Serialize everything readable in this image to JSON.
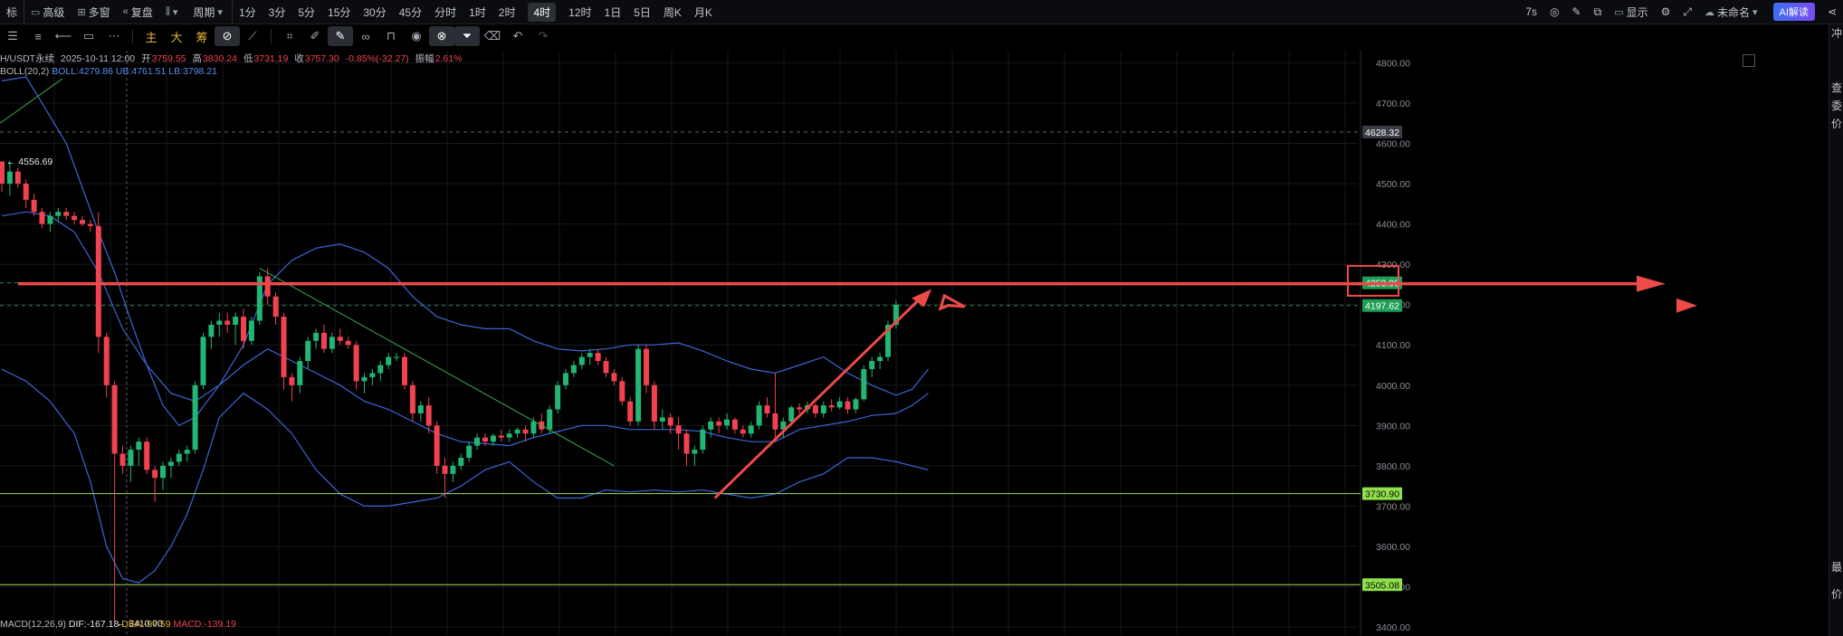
{
  "topbar": {
    "items": [
      {
        "label": "标",
        "icon": ""
      },
      {
        "label": "高级",
        "icon": "window-icon"
      },
      {
        "label": "多窗",
        "icon": "grid-icon"
      },
      {
        "label": "复盘",
        "icon": "rewind-icon"
      },
      {
        "label": "",
        "icon": "candle-icon"
      },
      {
        "label": "周期",
        "icon": ""
      }
    ],
    "periods": [
      "1分",
      "3分",
      "5分",
      "15分",
      "30分",
      "45分",
      "分时",
      "1时",
      "2时",
      "4时",
      "12时",
      "1日",
      "5日",
      "周K",
      "月K"
    ],
    "active_period": "4时",
    "right": {
      "refresh": "7s",
      "display": "显示",
      "layout_name": "未命名",
      "ai_button": "AI解读"
    }
  },
  "toolbar2": {
    "main": "主",
    "big": "大",
    "chip": "筹"
  },
  "info": {
    "symbol": "H/USDT永续",
    "datetime": "2025-10-11 12:00",
    "open_label": "开",
    "open": "3759.55",
    "high_label": "高",
    "high": "3830.24",
    "low_label": "低",
    "low": "3731.19",
    "close_label": "收",
    "close": "3757.30",
    "change": "-0.85%(-32.27)",
    "amp_label": "振幅",
    "amp": "2.61%"
  },
  "boll": {
    "name": "BOLL(20,2)",
    "mid": "BOLL:4279.86",
    "ub": "UB:4761.51",
    "lb": "LB:3798.21"
  },
  "macd": {
    "name": "MACD(12,26,9)",
    "dif": "DIF:-167.18",
    "dea": "DEA:-97.59",
    "macd": "MACD:-139.19"
  },
  "chart_data": {
    "type": "candlestick",
    "ylim": [
      3380,
      4830
    ],
    "y_ticks": [
      "4800.00",
      "4700.00",
      "4600.00",
      "4500.00",
      "4400.00",
      "4300.00",
      "4200.00",
      "4100.00",
      "4000.00",
      "3900.00",
      "3800.00",
      "3700.00",
      "3600.00",
      "3500.00",
      "3400.00"
    ],
    "candles": [
      [
        4555,
        4555,
        4480,
        4500
      ],
      [
        4500,
        4556.69,
        4470,
        4530
      ],
      [
        4530,
        4540,
        4490,
        4500
      ],
      [
        4500,
        4510,
        4440,
        4460
      ],
      [
        4460,
        4475,
        4420,
        4430
      ],
      [
        4430,
        4440,
        4390,
        4400
      ],
      [
        4400,
        4430,
        4380,
        4420
      ],
      [
        4420,
        4440,
        4405,
        4430
      ],
      [
        4430,
        4440,
        4410,
        4420
      ],
      [
        4420,
        4430,
        4400,
        4410
      ],
      [
        4410,
        4420,
        4395,
        4400
      ],
      [
        4400,
        4410,
        4380,
        4395
      ],
      [
        4395,
        4430,
        4080,
        4120
      ],
      [
        4120,
        4130,
        3970,
        4000
      ],
      [
        4000,
        4010,
        3410,
        3830
      ],
      [
        3830,
        3850,
        3780,
        3800
      ],
      [
        3800,
        3850,
        3760,
        3840
      ],
      [
        3840,
        3870,
        3800,
        3860
      ],
      [
        3860,
        3870,
        3780,
        3790
      ],
      [
        3790,
        3800,
        3710,
        3770
      ],
      [
        3770,
        3810,
        3740,
        3800
      ],
      [
        3800,
        3820,
        3770,
        3810
      ],
      [
        3810,
        3840,
        3800,
        3830
      ],
      [
        3830,
        3850,
        3810,
        3840
      ],
      [
        3840,
        4010,
        3830,
        4000
      ],
      [
        4000,
        4130,
        3990,
        4120
      ],
      [
        4120,
        4160,
        4090,
        4150
      ],
      [
        4150,
        4180,
        4120,
        4160
      ],
      [
        4160,
        4180,
        4130,
        4150
      ],
      [
        4150,
        4180,
        4100,
        4170
      ],
      [
        4170,
        4190,
        4090,
        4110
      ],
      [
        4110,
        4170,
        4100,
        4160
      ],
      [
        4160,
        4280,
        4150,
        4270
      ],
      [
        4270,
        4290,
        4200,
        4220
      ],
      [
        4220,
        4230,
        4150,
        4170
      ],
      [
        4170,
        4180,
        3990,
        4020
      ],
      [
        4020,
        4030,
        3960,
        4000
      ],
      [
        4000,
        4070,
        3980,
        4060
      ],
      [
        4060,
        4120,
        4040,
        4110
      ],
      [
        4110,
        4140,
        4090,
        4130
      ],
      [
        4130,
        4150,
        4080,
        4090
      ],
      [
        4090,
        4130,
        4080,
        4120
      ],
      [
        4120,
        4140,
        4100,
        4110
      ],
      [
        4110,
        4120,
        4090,
        4100
      ],
      [
        4100,
        4110,
        3990,
        4010
      ],
      [
        4010,
        4030,
        3980,
        4020
      ],
      [
        4020,
        4040,
        4000,
        4030
      ],
      [
        4030,
        4060,
        4010,
        4050
      ],
      [
        4050,
        4080,
        4040,
        4070
      ],
      [
        4070,
        4080,
        4060,
        4070
      ],
      [
        4070,
        4080,
        3990,
        4000
      ],
      [
        4000,
        4010,
        3910,
        3930
      ],
      [
        3930,
        3960,
        3910,
        3950
      ],
      [
        3950,
        3970,
        3880,
        3900
      ],
      [
        3900,
        3910,
        3780,
        3800
      ],
      [
        3800,
        3820,
        3720,
        3780
      ],
      [
        3780,
        3810,
        3760,
        3800
      ],
      [
        3800,
        3830,
        3790,
        3820
      ],
      [
        3820,
        3860,
        3810,
        3850
      ],
      [
        3850,
        3880,
        3840,
        3870
      ],
      [
        3870,
        3880,
        3850,
        3860
      ],
      [
        3860,
        3880,
        3850,
        3875
      ],
      [
        3875,
        3890,
        3860,
        3870
      ],
      [
        3870,
        3890,
        3860,
        3880
      ],
      [
        3880,
        3895,
        3870,
        3890
      ],
      [
        3890,
        3900,
        3860,
        3880
      ],
      [
        3880,
        3920,
        3870,
        3910
      ],
      [
        3910,
        3930,
        3880,
        3890
      ],
      [
        3890,
        3950,
        3880,
        3940
      ],
      [
        3940,
        4010,
        3930,
        4000
      ],
      [
        4000,
        4040,
        3990,
        4030
      ],
      [
        4030,
        4060,
        4020,
        4050
      ],
      [
        4050,
        4080,
        4040,
        4070
      ],
      [
        4070,
        4090,
        4050,
        4080
      ],
      [
        4080,
        4090,
        4050,
        4060
      ],
      [
        4060,
        4070,
        4020,
        4030
      ],
      [
        4030,
        4040,
        4000,
        4010
      ],
      [
        4010,
        4020,
        3950,
        3960
      ],
      [
        3960,
        3970,
        3900,
        3910
      ],
      [
        3910,
        4100,
        3900,
        4090
      ],
      [
        4090,
        4100,
        3980,
        4000
      ],
      [
        4000,
        4010,
        3890,
        3910
      ],
      [
        3910,
        3940,
        3890,
        3920
      ],
      [
        3920,
        3930,
        3880,
        3900
      ],
      [
        3900,
        3920,
        3840,
        3880
      ],
      [
        3880,
        3890,
        3800,
        3830
      ],
      [
        3830,
        3850,
        3800,
        3840
      ],
      [
        3840,
        3900,
        3830,
        3890
      ],
      [
        3890,
        3920,
        3870,
        3910
      ],
      [
        3910,
        3920,
        3880,
        3900
      ],
      [
        3900,
        3930,
        3890,
        3915
      ],
      [
        3915,
        3920,
        3880,
        3890
      ],
      [
        3890,
        3900,
        3870,
        3880
      ],
      [
        3880,
        3910,
        3870,
        3900
      ],
      [
        3900,
        3960,
        3890,
        3950
      ],
      [
        3950,
        3970,
        3920,
        3930
      ],
      [
        3930,
        4030,
        3860,
        3890
      ],
      [
        3890,
        3920,
        3870,
        3910
      ],
      [
        3910,
        3950,
        3900,
        3945
      ],
      [
        3945,
        3955,
        3930,
        3940
      ],
      [
        3940,
        3960,
        3930,
        3950
      ],
      [
        3950,
        3955,
        3920,
        3930
      ],
      [
        3930,
        3960,
        3920,
        3950
      ],
      [
        3950,
        3965,
        3935,
        3945
      ],
      [
        3945,
        3970,
        3940,
        3960
      ],
      [
        3960,
        3970,
        3930,
        3940
      ],
      [
        3940,
        3970,
        3930,
        3965
      ],
      [
        3965,
        4050,
        3960,
        4040
      ],
      [
        4040,
        4070,
        4020,
        4060
      ],
      [
        4060,
        4080,
        4040,
        4070
      ],
      [
        4070,
        4160,
        4060,
        4150
      ],
      [
        4150,
        4210,
        4140,
        4200
      ]
    ],
    "boll_upper": [
      [
        0,
        4755
      ],
      [
        3,
        4765
      ],
      [
        5,
        4700
      ],
      [
        8,
        4600
      ],
      [
        10,
        4490
      ],
      [
        12,
        4380
      ],
      [
        14,
        4280
      ],
      [
        16,
        4160
      ],
      [
        18,
        4050
      ],
      [
        20,
        3950
      ],
      [
        22,
        3900
      ],
      [
        24,
        3920
      ],
      [
        27,
        4000
      ],
      [
        30,
        4100
      ],
      [
        33,
        4250
      ],
      [
        36,
        4310
      ],
      [
        39,
        4340
      ],
      [
        42,
        4350
      ],
      [
        45,
        4330
      ],
      [
        48,
        4290
      ],
      [
        51,
        4220
      ],
      [
        54,
        4170
      ],
      [
        57,
        4150
      ],
      [
        60,
        4140
      ],
      [
        63,
        4140
      ],
      [
        66,
        4110
      ],
      [
        69,
        4090
      ],
      [
        72,
        4085
      ],
      [
        75,
        4090
      ],
      [
        78,
        4100
      ],
      [
        81,
        4100
      ],
      [
        84,
        4105
      ],
      [
        87,
        4085
      ],
      [
        90,
        4060
      ],
      [
        93,
        4040
      ],
      [
        96,
        4030
      ],
      [
        99,
        4050
      ],
      [
        102,
        4070
      ],
      [
        105,
        4030
      ],
      [
        108,
        4000
      ],
      [
        111,
        3975
      ],
      [
        113,
        3990
      ],
      [
        115,
        4040
      ]
    ],
    "boll_middle": [
      [
        0,
        4420
      ],
      [
        3,
        4430
      ],
      [
        6,
        4420
      ],
      [
        9,
        4380
      ],
      [
        12,
        4280
      ],
      [
        15,
        4140
      ],
      [
        18,
        4050
      ],
      [
        21,
        3980
      ],
      [
        24,
        3960
      ],
      [
        27,
        4000
      ],
      [
        30,
        4050
      ],
      [
        33,
        4090
      ],
      [
        36,
        4060
      ],
      [
        39,
        4030
      ],
      [
        42,
        4000
      ],
      [
        45,
        3960
      ],
      [
        48,
        3940
      ],
      [
        51,
        3910
      ],
      [
        54,
        3880
      ],
      [
        57,
        3860
      ],
      [
        60,
        3855
      ],
      [
        63,
        3850
      ],
      [
        66,
        3870
      ],
      [
        69,
        3885
      ],
      [
        72,
        3900
      ],
      [
        75,
        3900
      ],
      [
        78,
        3890
      ],
      [
        81,
        3890
      ],
      [
        84,
        3890
      ],
      [
        87,
        3885
      ],
      [
        90,
        3870
      ],
      [
        93,
        3860
      ],
      [
        96,
        3860
      ],
      [
        99,
        3890
      ],
      [
        102,
        3900
      ],
      [
        105,
        3910
      ],
      [
        108,
        3925
      ],
      [
        111,
        3930
      ],
      [
        113,
        3950
      ],
      [
        115,
        3980
      ]
    ],
    "boll_lower": [
      [
        0,
        4040
      ],
      [
        3,
        4010
      ],
      [
        6,
        3960
      ],
      [
        9,
        3880
      ],
      [
        11,
        3760
      ],
      [
        13,
        3600
      ],
      [
        15,
        3520
      ],
      [
        17,
        3510
      ],
      [
        19,
        3540
      ],
      [
        21,
        3600
      ],
      [
        23,
        3680
      ],
      [
        25,
        3790
      ],
      [
        27,
        3920
      ],
      [
        30,
        3980
      ],
      [
        33,
        3940
      ],
      [
        36,
        3880
      ],
      [
        39,
        3790
      ],
      [
        42,
        3730
      ],
      [
        45,
        3700
      ],
      [
        48,
        3700
      ],
      [
        51,
        3710
      ],
      [
        54,
        3720
      ],
      [
        57,
        3750
      ],
      [
        60,
        3790
      ],
      [
        63,
        3810
      ],
      [
        66,
        3760
      ],
      [
        69,
        3720
      ],
      [
        72,
        3720
      ],
      [
        75,
        3740
      ],
      [
        78,
        3735
      ],
      [
        81,
        3740
      ],
      [
        84,
        3735
      ],
      [
        87,
        3740
      ],
      [
        90,
        3730
      ],
      [
        93,
        3720
      ],
      [
        96,
        3730
      ],
      [
        99,
        3760
      ],
      [
        102,
        3780
      ],
      [
        105,
        3820
      ],
      [
        108,
        3820
      ],
      [
        111,
        3810
      ],
      [
        113,
        3800
      ],
      [
        115,
        3790
      ]
    ],
    "hlines": [
      {
        "value": 4628.32,
        "label": "4628.32",
        "style": "dashed",
        "color": "#8b8f98"
      },
      {
        "value": 4253.98,
        "label": "4253.98",
        "style": "dashed",
        "color": "#31c26c"
      },
      {
        "value": 4197.62,
        "label": "4197.62",
        "style": "dashed",
        "color": "#31c26c"
      },
      {
        "value": 3730.9,
        "label": "3730.90",
        "style": "solid",
        "color": "#9ae05a"
      },
      {
        "value": 3505.08,
        "label": "3505.08",
        "style": "solid",
        "color": "#9ae05a"
      }
    ],
    "annotations": {
      "high_marker": "4556.69",
      "low_marker": "3410.00"
    },
    "colors": {
      "up": "#22b573",
      "down": "#f0424f",
      "boll": "#3c66d6",
      "arrow": "#ee4a4a",
      "grid": "#16181d"
    }
  },
  "order_panel": [
    "冲",
    "查",
    "委",
    "价",
    "最",
    "价"
  ]
}
